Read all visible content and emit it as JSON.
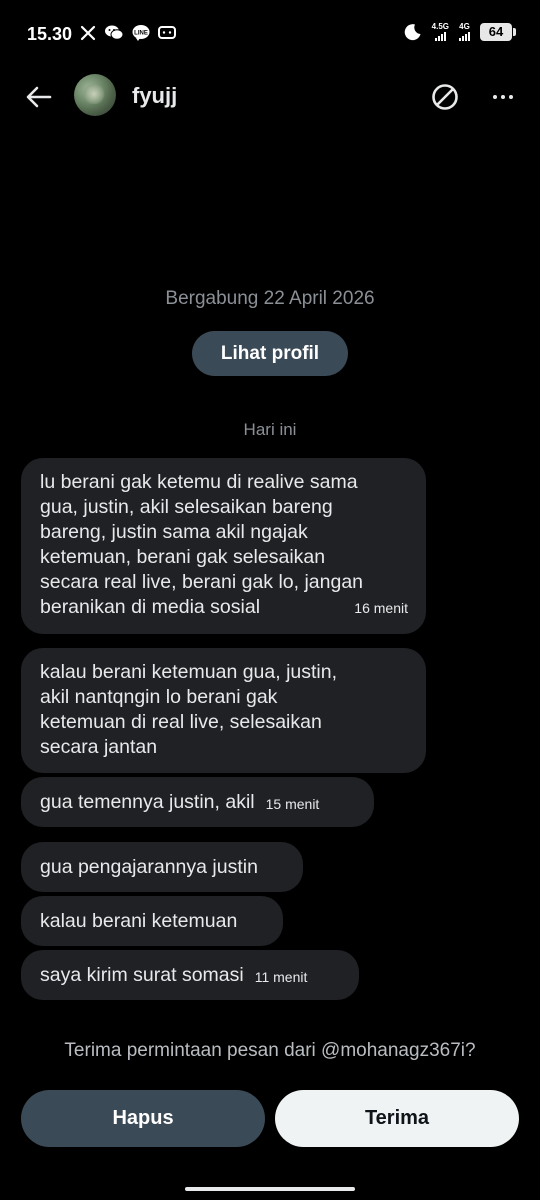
{
  "status_bar": {
    "time": "15.30",
    "icons_left": [
      "x-logo-icon",
      "wechat-icon",
      "line-icon",
      "message-icon"
    ],
    "network_1": "4.5G",
    "network_2": "4G",
    "battery": "64"
  },
  "header": {
    "username": "fyujj"
  },
  "info": {
    "joined": "Bergabung 22 April 2026",
    "profile_button": "Lihat profil"
  },
  "day_separator": "Hari ini",
  "messages": [
    {
      "text": "lu berani gak ketemu di realive sama\ngua, justin, akil selesaikan bareng\nbareng, justin sama akil ngajak\nketemuan, berani gak selesaikan\nsecara real live, berani gak lo, jangan\nberanikan di media sosial",
      "time": "16 menit"
    },
    {
      "text": "kalau berani ketemuan gua, justin,\nakil nantqngin lo berani gak\nketemuan di real live, selesaikan\nsecara jantan",
      "time": ""
    },
    {
      "text": "gua temennya justin, akil",
      "time": "15 menit"
    },
    {
      "text": "gua pengajarannya justin",
      "time": ""
    },
    {
      "text": "kalau berani ketemuan",
      "time": ""
    },
    {
      "text": "saya kirim surat somasi",
      "time": "11 menit"
    }
  ],
  "request": {
    "prompt": "Terima permintaan pesan dari @mohanagz367i?",
    "delete_label": "Hapus",
    "accept_label": "Terima"
  },
  "colors": {
    "background": "#000000",
    "bubble": "#1f2124",
    "secondary_button": "#3b4a57",
    "primary_button": "#eff3f4",
    "muted_text": "#8b9096"
  }
}
